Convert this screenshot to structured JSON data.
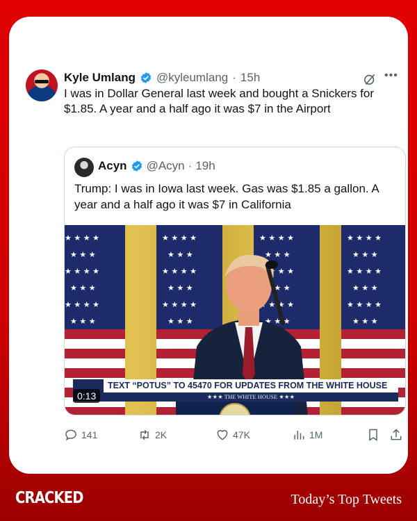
{
  "tweet": {
    "author_name": "Kyle Umlang",
    "handle": "@kyleumlang",
    "separator": "·",
    "time": "15h",
    "more_icon": "more-icon",
    "text": "I was in Dollar General last week and bought a Snickers for $1.85. A year and a half ago it was $7 in the Airport"
  },
  "quote": {
    "author_name": "Acyn",
    "handle": "@Acyn",
    "separator": "·",
    "time": "19h",
    "text": "Trump: I was in Iowa last week. Gas was $1.85 a gallon. A year and a half ago it was $7 in California",
    "video": {
      "banner_text": "TEXT “POTUS” TO 45470 FOR UPDATES FROM THE WHITE HOUSE",
      "banner_sub": "★★★  THE WHITE HOUSE  ★★★",
      "timecode": "0:13"
    }
  },
  "actions": {
    "replies": "141",
    "reposts": "2K",
    "likes": "47K",
    "views": "1M"
  },
  "footer": {
    "brand": "CRACKED",
    "title": "Today’s Top Tweets"
  },
  "colors": {
    "background_red": "#d00000",
    "verified_blue": "#1d9bf0",
    "text_primary": "#0f1419",
    "text_secondary": "#536471"
  }
}
